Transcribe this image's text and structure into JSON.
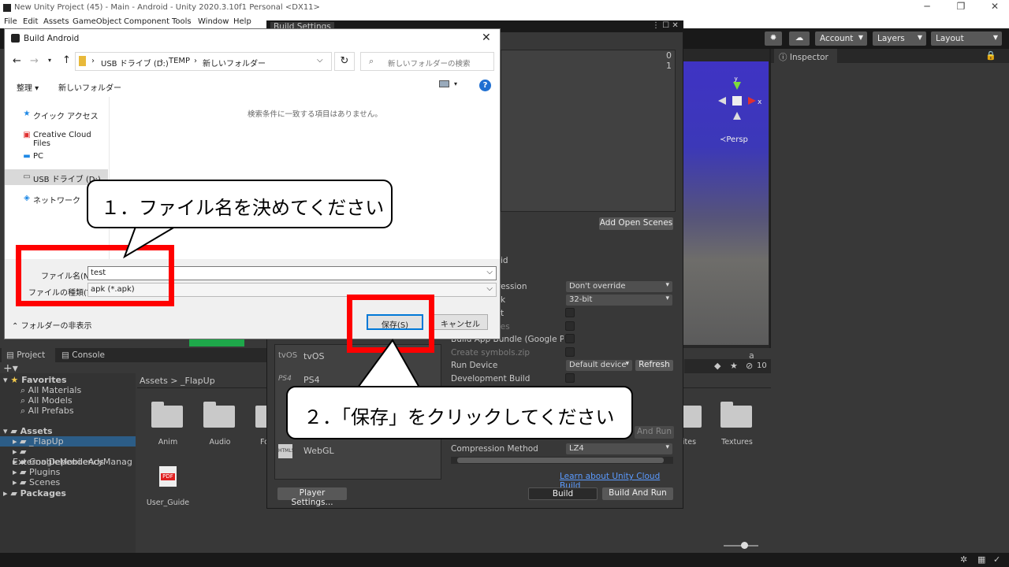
{
  "window": {
    "title": "New Unity Project (45) - Main - Android - Unity 2020.3.10f1 Personal <DX11>"
  },
  "menu": [
    "File",
    "Edit",
    "Assets",
    "GameObject",
    "Component",
    "Tools",
    "Window",
    "Help"
  ],
  "toolbar": {
    "account": "Account",
    "layers": "Layers",
    "layout": "Layout"
  },
  "inspector": {
    "tab": "Inspector"
  },
  "scene": {
    "persp": "≺Persp",
    "axis_y": "y",
    "axis_x": "x"
  },
  "build_settings": {
    "title": "Build Settings",
    "scene_index_0": "0",
    "scene_index_1": "1",
    "add_open_scenes": "Add Open Scenes",
    "platforms": [
      "tvOS",
      "PS4",
      "WebGL"
    ],
    "platform_icons": {
      "tvOS": "tvOS",
      "PS4": "PS4",
      "WebGL": "HTML5"
    },
    "rows": {
      "partial_1": "id",
      "compression_label": "ression",
      "compression_value": "Don't override",
      "arch_label": "k",
      "arch_value": "32-bit",
      "partial_2": "t",
      "partial_3": "ces",
      "build_app_bundle": "Build App Bundle (Google Play)",
      "create_symbols": "Create symbols.zip",
      "run_device": "Run Device",
      "run_device_value": "Default device",
      "refresh": "Refresh",
      "development_build": "Development Build",
      "patch_and_run": "And Run",
      "compression_method": "Compression Method",
      "compression_method_value": "LZ4"
    },
    "learn_link": "Learn about Unity Cloud Build",
    "player_settings": "Player Settings...",
    "build": "Build",
    "build_and_run": "Build And Run"
  },
  "project": {
    "tabs": [
      "Project",
      "Console"
    ],
    "favorites_header": "Favorites",
    "favorites": [
      "All Materials",
      "All Models",
      "All Prefabs"
    ],
    "assets_header": "Assets",
    "assets_tree": [
      "_FlapUp",
      "ExternalDependencyManag",
      "GoogleMobileAds",
      "Plugins",
      "Scenes"
    ],
    "packages": "Packages",
    "breadcrumb": [
      "Assets",
      "_FlapUp"
    ],
    "folders": [
      "Anim",
      "Audio",
      "Fo",
      "rites",
      "Textures"
    ],
    "files": [
      "User_Guide"
    ],
    "icon_count": "10"
  },
  "dialog": {
    "title": "Build Android",
    "breadcrumb": [
      "USB ドライブ (D:)",
      "TEMP",
      "新しいフォルダー"
    ],
    "search_placeholder": "新しいフォルダーの検索",
    "organize": "整理 ▾",
    "new_folder": "新しいフォルダー",
    "empty_message": "検索条件に一致する項目はありません。",
    "nav_items": [
      "クイック アクセス",
      "Creative Cloud Files",
      "PC",
      "USB ドライブ (D:)",
      "ネットワーク"
    ],
    "filename_label": "ファイル名(N):",
    "filename_value": "test",
    "filetype_label": "ファイルの種類(T):",
    "filetype_value": "apk (*.apk)",
    "hide_folders": "フォルダーの非表示",
    "save_button": "保存(S)",
    "cancel_button": "キャンセル"
  },
  "annotations": {
    "step1": "１．ファイル名を決めてください",
    "step2": "２．「保存」をクリックしてください"
  },
  "colors": {
    "highlight": "#ff0000",
    "link": "#5b9bff",
    "unity_dark": "#383838"
  }
}
